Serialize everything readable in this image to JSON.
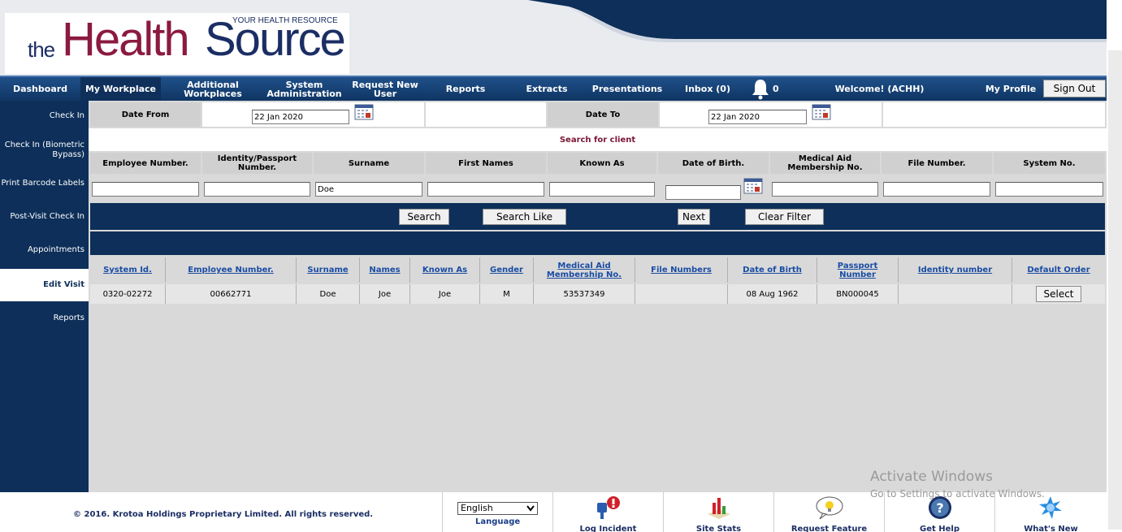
{
  "brand": {
    "the": "the",
    "health": "Health",
    "source": "Source",
    "tagline": "YOUR HEALTH RESOURCE",
    "colors": {
      "navy": "#0d2f59",
      "maroon": "#8b1a3f"
    }
  },
  "nav": {
    "items": [
      {
        "label": "Dashboard"
      },
      {
        "label": "My Workplace"
      },
      {
        "label": "Additional Workplaces"
      },
      {
        "label": "System Administration"
      },
      {
        "label": "Request New User"
      },
      {
        "label": "Reports"
      },
      {
        "label": "Extracts"
      },
      {
        "label": "Presentations"
      },
      {
        "label": "Inbox (0)"
      }
    ],
    "bell_icon": "bell-icon",
    "notification_count": "0",
    "welcome": "Welcome! (ACHH)",
    "my_profile": "My Profile",
    "sign_out": "Sign Out"
  },
  "sidebar": {
    "items": [
      {
        "label": "Check In"
      },
      {
        "label": "Check In (Biometric Bypass)"
      },
      {
        "label": "Print Barcode Labels"
      },
      {
        "label": "Post-Visit Check In"
      },
      {
        "label": "Appointments"
      },
      {
        "label": "Edit Visit"
      },
      {
        "label": "Reports"
      }
    ],
    "active": "Edit Visit"
  },
  "date_filter": {
    "from_label": "Date From",
    "from_value": "22 Jan 2020",
    "to_label": "Date To",
    "to_value": "22 Jan 2020",
    "calendar_icon": "calendar-icon"
  },
  "search": {
    "title": "Search for client",
    "headers": [
      "Employee Number.",
      "Identity/Passport Number.",
      "Surname",
      "First Names",
      "Known As",
      "Date of Birth.",
      "Medical Aid Membership No.",
      "File Number.",
      "System No."
    ],
    "values": [
      "",
      "",
      "Doe",
      "",
      "",
      "",
      "",
      "",
      ""
    ],
    "buttons": {
      "search": "Search",
      "search_like": "Search Like",
      "next": "Next",
      "clear_filter": "Clear Filter"
    }
  },
  "results": {
    "headers": [
      "System Id.",
      "Employee Number.",
      "Surname",
      "Names",
      "Known As",
      "Gender",
      "Medical Aid Membership No.",
      "File Numbers",
      "Date of Birth",
      "Passport Number",
      "Identity number",
      "Default Order"
    ],
    "rows": [
      {
        "cells": [
          "0320-02272",
          "00662771",
          "Doe",
          "Joe",
          "Joe",
          "M",
          "53537349",
          "",
          "08 Aug 1962",
          "BN000045",
          ""
        ],
        "action": "Select"
      }
    ]
  },
  "footer": {
    "copyright": "© 2016. Krotoa Holdings Proprietary Limited. All rights reserved.",
    "language_value": "English",
    "language_label": "Language",
    "tiles": [
      {
        "icon": "log-incident-icon",
        "label": "Log Incident"
      },
      {
        "icon": "site-stats-icon",
        "label": "Site Stats"
      },
      {
        "icon": "request-feature-icon",
        "label": "Request Feature"
      },
      {
        "icon": "help-icon",
        "label": "Get Help"
      },
      {
        "icon": "whats-new-icon",
        "label": "What's New"
      }
    ]
  },
  "watermark": {
    "line1": "Activate Windows",
    "line2": "Go to Settings to activate Windows."
  }
}
